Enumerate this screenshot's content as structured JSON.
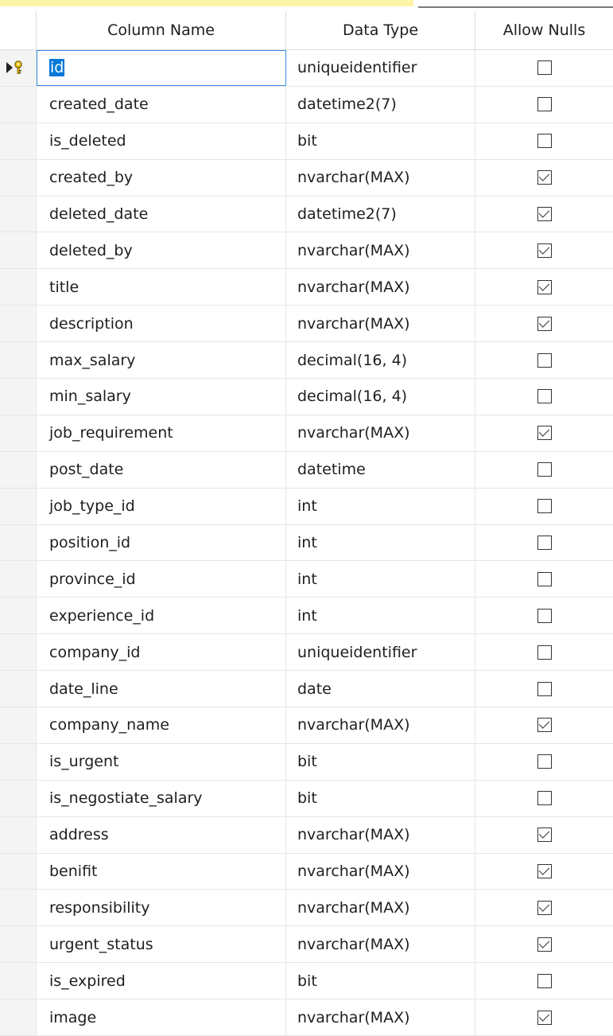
{
  "header": {
    "column_name": "Column Name",
    "data_type": "Data Type",
    "allow_nulls": "Allow Nulls"
  },
  "rows": [
    {
      "name": "id",
      "type": "uniqueidentifier",
      "allow_nulls": false,
      "primary_key": true,
      "selected": true
    },
    {
      "name": "created_date",
      "type": "datetime2(7)",
      "allow_nulls": false
    },
    {
      "name": "is_deleted",
      "type": "bit",
      "allow_nulls": false
    },
    {
      "name": "created_by",
      "type": "nvarchar(MAX)",
      "allow_nulls": true
    },
    {
      "name": "deleted_date",
      "type": "datetime2(7)",
      "allow_nulls": true
    },
    {
      "name": "deleted_by",
      "type": "nvarchar(MAX)",
      "allow_nulls": true
    },
    {
      "name": "title",
      "type": "nvarchar(MAX)",
      "allow_nulls": true
    },
    {
      "name": "description",
      "type": "nvarchar(MAX)",
      "allow_nulls": true
    },
    {
      "name": "max_salary",
      "type": "decimal(16, 4)",
      "allow_nulls": false
    },
    {
      "name": "min_salary",
      "type": "decimal(16, 4)",
      "allow_nulls": false
    },
    {
      "name": "job_requirement",
      "type": "nvarchar(MAX)",
      "allow_nulls": true
    },
    {
      "name": "post_date",
      "type": "datetime",
      "allow_nulls": false
    },
    {
      "name": "job_type_id",
      "type": "int",
      "allow_nulls": false
    },
    {
      "name": "position_id",
      "type": "int",
      "allow_nulls": false
    },
    {
      "name": "province_id",
      "type": "int",
      "allow_nulls": false
    },
    {
      "name": "experience_id",
      "type": "int",
      "allow_nulls": false
    },
    {
      "name": "company_id",
      "type": "uniqueidentifier",
      "allow_nulls": false
    },
    {
      "name": "date_line",
      "type": "date",
      "allow_nulls": false
    },
    {
      "name": "company_name",
      "type": "nvarchar(MAX)",
      "allow_nulls": true
    },
    {
      "name": "is_urgent",
      "type": "bit",
      "allow_nulls": false
    },
    {
      "name": "is_negostiate_salary",
      "type": "bit",
      "allow_nulls": false
    },
    {
      "name": "address",
      "type": "nvarchar(MAX)",
      "allow_nulls": true
    },
    {
      "name": "benifit",
      "type": "nvarchar(MAX)",
      "allow_nulls": true
    },
    {
      "name": "responsibility",
      "type": "nvarchar(MAX)",
      "allow_nulls": true
    },
    {
      "name": "urgent_status",
      "type": "nvarchar(MAX)",
      "allow_nulls": true
    },
    {
      "name": "is_expired",
      "type": "bit",
      "allow_nulls": false
    },
    {
      "name": "image",
      "type": "nvarchar(MAX)",
      "allow_nulls": true
    }
  ],
  "colors": {
    "selection": "#0078d7",
    "active_border": "#3c8be8",
    "key_icon": "#f2c200",
    "tab_accent": "#fdf3a8"
  },
  "icons": {
    "row_indicator": "current-row-arrow-icon",
    "primary_key": "key-icon"
  }
}
